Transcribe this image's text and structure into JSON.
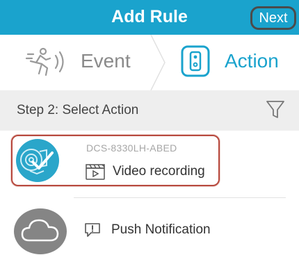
{
  "header": {
    "title": "Add Rule",
    "next_label": "Next"
  },
  "tabs": {
    "event_label": "Event",
    "action_label": "Action",
    "active": "Action"
  },
  "section": {
    "title": "Step 2: Select Action"
  },
  "actions": [
    {
      "device_name": "DCS-8330LH-ABED",
      "action_label": "Video recording",
      "icon": "camera-icon",
      "selected": true
    },
    {
      "action_label": "Push Notification",
      "icon": "cloud-icon",
      "selected": false
    }
  ],
  "colors": {
    "brand": "#1aa3cd",
    "selection_border": "#b84a3f",
    "section_bg": "#eeeeee"
  }
}
